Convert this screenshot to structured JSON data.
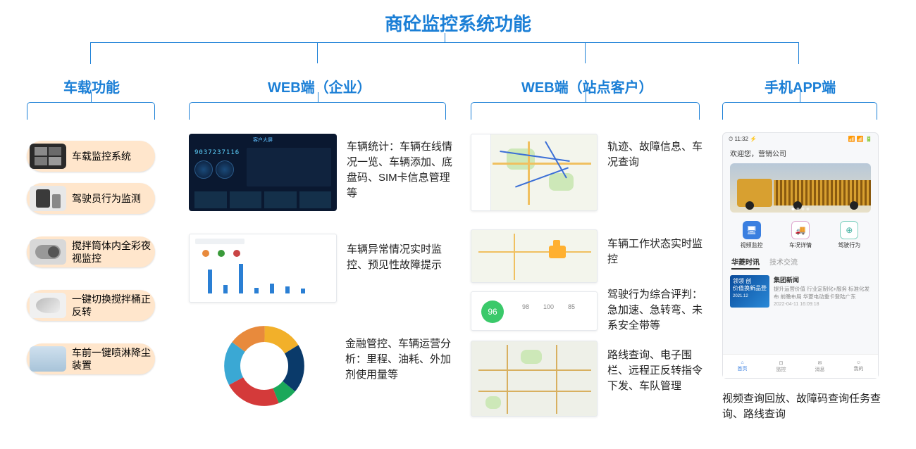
{
  "title": "商砼监控系统功能",
  "columns": [
    {
      "title": "车载功能"
    },
    {
      "title": "WEB端（企业）"
    },
    {
      "title": "WEB端（站点客户）"
    },
    {
      "title": "手机APP端"
    }
  ],
  "col1": {
    "items": [
      {
        "label": "车载监控系统"
      },
      {
        "label": "驾驶员行为监测"
      },
      {
        "label": "搅拌筒体内全彩夜视监控"
      },
      {
        "label": "一键切换搅拌桶正反转"
      },
      {
        "label": "车前一键喷淋降尘装置"
      }
    ]
  },
  "col2": {
    "counter": "9037237116",
    "desc1": "车辆统计：车辆在线情况一览、车辆添加、底盘码、SIM卡信息管理等",
    "desc2": "车辆异常情况实时监控、预见性故障提示",
    "desc3": "金融管控、车辆运营分析：里程、油耗、外加剂使用量等"
  },
  "col3": {
    "desc1": "轨迹、故障信息、车况查询",
    "desc2": "车辆工作状态实时监控",
    "desc3": "驾驶行为综合评判：急加速、急转弯、未系安全带等",
    "desc4": "路线查询、电子围栏、远程正反转指令下发、车队管理",
    "score": "96",
    "scores": {
      "a": "98",
      "b": "100",
      "c": "85"
    }
  },
  "col4": {
    "statusTime": "11:32",
    "welcome": "欢迎您，营销公司",
    "tabs": {
      "a": "视频监控",
      "b": "车况详情",
      "c": "驾驶行为"
    },
    "subtabs": {
      "a": "华菱时讯",
      "b": "技术交流"
    },
    "news": {
      "title": "集团新闻",
      "body": "提升运营价值 行业定制化+服务 标准化发布 前瞻布局 华菱电动重卡登陆广东",
      "date": "2022-04-11 16:09:18"
    },
    "nav": {
      "a": "首页",
      "b": "监控",
      "c": "消息",
      "d": "我的"
    },
    "summary": "视频查询回放、故障码查询任务查询、路线查询"
  }
}
